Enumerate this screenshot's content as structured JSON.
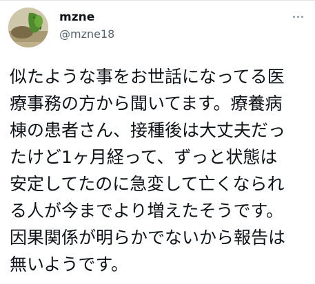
{
  "user": {
    "display_name": "mzne",
    "handle": "@mzne18",
    "avatar_icon": "avatar-photo-icon"
  },
  "menu": {
    "more_icon": "more-horizontal-icon"
  },
  "tweet": {
    "lines": [
      "似たような事をお世話になってる医",
      "療事務の方から聞いてます。療養病",
      "棟の患者さん、接種後は大丈夫だっ",
      "たけど1ヶ月経って、ずっと状態は",
      "安定してたのに急変して亡くなられ",
      "る人が今までより増えたそうです。",
      "因果関係が明らかでないから報告は",
      "無いようです。"
    ]
  }
}
